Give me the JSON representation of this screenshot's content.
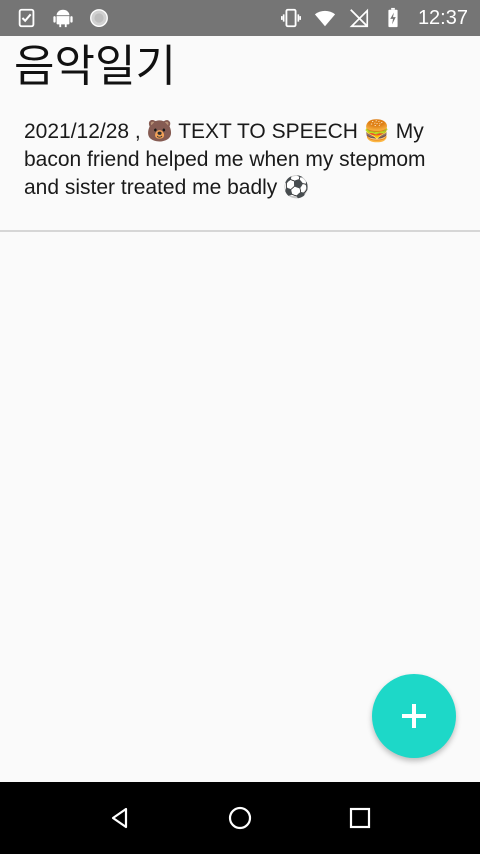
{
  "status_bar": {
    "time": "12:37",
    "left_icons": [
      "task-check-icon",
      "android-icon",
      "circle-dotted-icon"
    ],
    "right_icons": [
      "vibrate-icon",
      "wifi-icon",
      "no-sim-icon",
      "battery-charging-icon"
    ]
  },
  "app": {
    "title": "음악일기"
  },
  "entries": [
    {
      "text": "2021/12/28 , 🐻 TEXT TO SPEECH 🍔 My bacon friend helped me when my stepmom and sister treated me badly ⚽"
    }
  ],
  "fab": {
    "icon": "plus-icon",
    "color": "#1dd8c8"
  },
  "nav_bar": {
    "buttons": [
      "back-icon",
      "home-icon",
      "recents-icon"
    ]
  }
}
